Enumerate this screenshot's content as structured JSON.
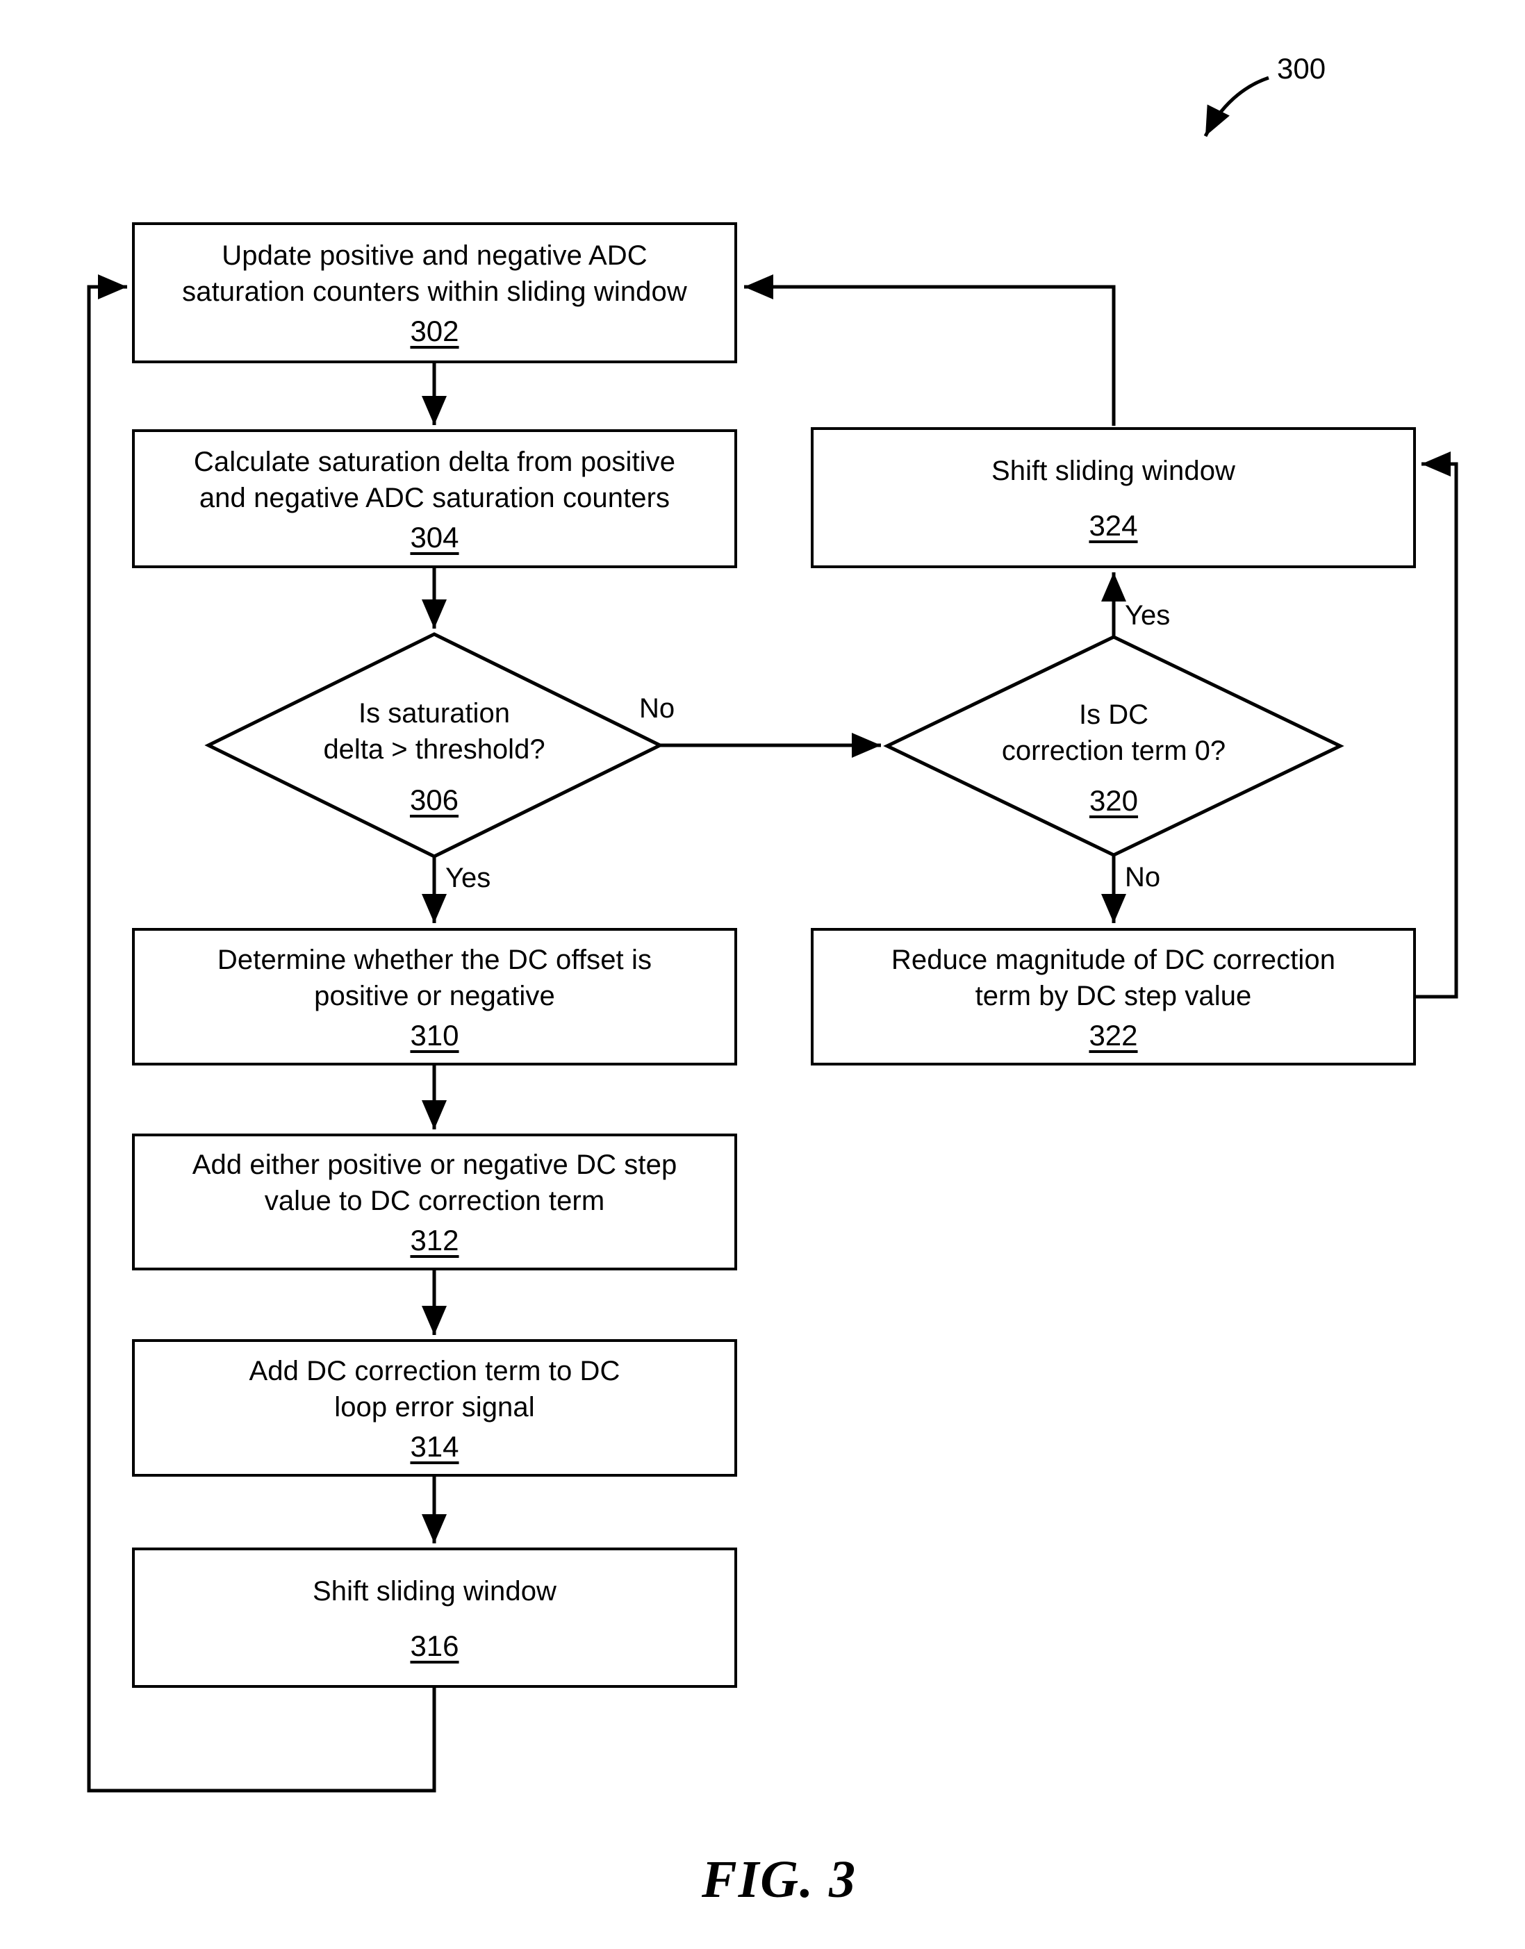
{
  "figure": {
    "caption": "FIG. 3",
    "diagram_ref": "300"
  },
  "nodes": [
    {
      "id": "302",
      "type": "process",
      "text": "Update positive and negative ADC\nsaturation counters within sliding window",
      "ref": "302"
    },
    {
      "id": "304",
      "type": "process",
      "text": "Calculate saturation delta from positive\nand negative ADC saturation counters",
      "ref": "304"
    },
    {
      "id": "306",
      "type": "decision",
      "text": "Is saturation\ndelta > threshold?",
      "ref": "306"
    },
    {
      "id": "310",
      "type": "process",
      "text": "Determine whether the DC offset is\npositive or negative",
      "ref": "310"
    },
    {
      "id": "312",
      "type": "process",
      "text": "Add either positive or negative DC step\nvalue to DC correction term",
      "ref": "312"
    },
    {
      "id": "314",
      "type": "process",
      "text": "Add DC correction term to DC\nloop error signal",
      "ref": "314"
    },
    {
      "id": "316",
      "type": "process",
      "text": "Shift sliding window",
      "ref": "316"
    },
    {
      "id": "320",
      "type": "decision",
      "text": "Is DC\ncorrection term 0?",
      "ref": "320"
    },
    {
      "id": "322",
      "type": "process",
      "text": "Reduce magnitude of DC correction\nterm by DC step value",
      "ref": "322"
    },
    {
      "id": "324",
      "type": "process",
      "text": "Shift sliding window",
      "ref": "324"
    }
  ],
  "edge_labels": {
    "no_306": "No",
    "yes_306": "Yes",
    "yes_320": "Yes",
    "no_320": "No"
  },
  "colors": {
    "stroke": "#000000",
    "fill": "#ffffff",
    "text": "#000000"
  }
}
